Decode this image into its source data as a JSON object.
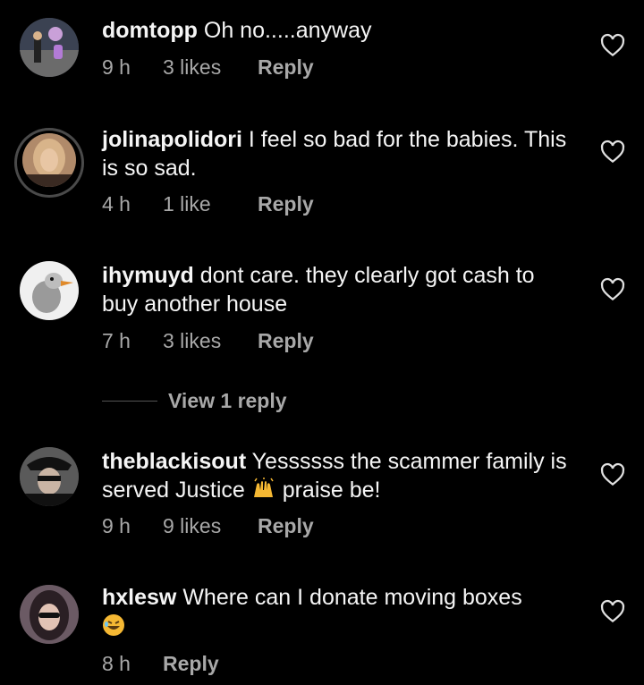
{
  "comments": [
    {
      "username": "domtopp",
      "text": "Oh no.....anyway",
      "time": "9 h",
      "likes": "3 likes",
      "reply": "Reply"
    },
    {
      "username": "jolinapolidori",
      "text": "I feel so bad for the babies. This is so sad.",
      "time": "4 h",
      "likes": "1 like",
      "reply": "Reply"
    },
    {
      "username": "ihymuyd",
      "text": "dont care. they clearly got cash to buy another house",
      "time": "7 h",
      "likes": "3 likes",
      "reply": "Reply"
    },
    {
      "username": "theblackisout",
      "text_a": "Yessssss the scammer family is served Justice",
      "emoji": "raised-hands-emoji",
      "text_b": "praise be!",
      "time": "9 h",
      "likes": "9 likes",
      "reply": "Reply"
    },
    {
      "username": "hxlesw",
      "text": "Where can I donate moving boxes",
      "emoji": "rolling-laughing-emoji",
      "time": "8 h",
      "reply": "Reply"
    }
  ],
  "view_replies": "View 1 reply",
  "colors": {
    "background": "#000000",
    "text": "#f5f5f5",
    "meta": "#a8a8a8",
    "emoji": "#f5b833"
  },
  "icons": [
    "heart-icon",
    "raised-hands-emoji",
    "rolling-laughing-emoji"
  ]
}
